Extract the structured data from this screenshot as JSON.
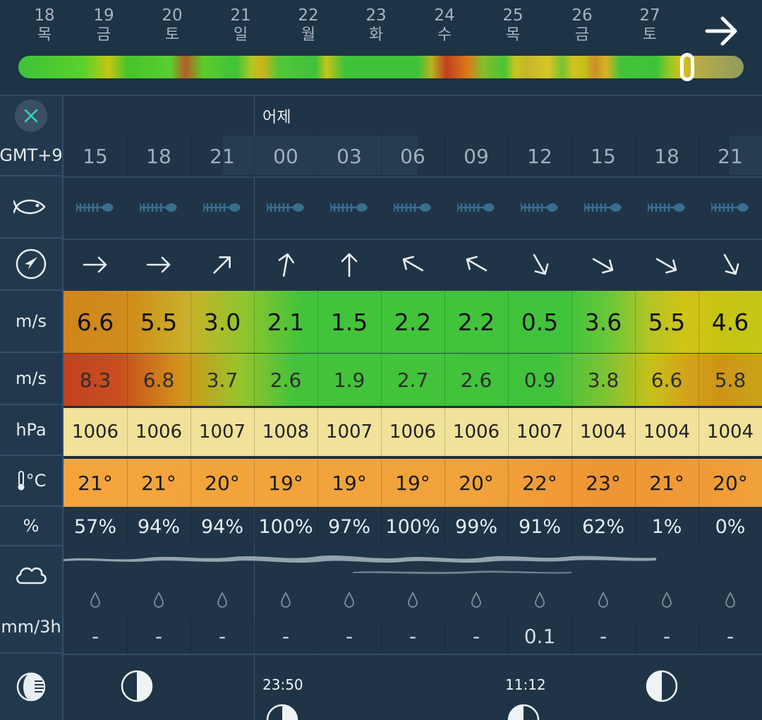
{
  "days": [
    {
      "num": "18",
      "wd": "목"
    },
    {
      "num": "19",
      "wd": "금"
    },
    {
      "num": "20",
      "wd": "토"
    },
    {
      "num": "21",
      "wd": "일"
    },
    {
      "num": "22",
      "wd": "월"
    },
    {
      "num": "23",
      "wd": "화"
    },
    {
      "num": "24",
      "wd": "수"
    },
    {
      "num": "25",
      "wd": "목"
    },
    {
      "num": "26",
      "wd": "금"
    },
    {
      "num": "27",
      "wd": "토"
    }
  ],
  "day_section_label": "어제",
  "labels": {
    "timezone": "GMT+9",
    "wind_unit": "m/s",
    "gust_unit": "m/s",
    "pressure_unit": "hPa",
    "temp_unit": "°C",
    "humidity_unit": "%",
    "precip_unit": "mm/3h"
  },
  "hours": [
    "15",
    "18",
    "21",
    "00",
    "03",
    "06",
    "09",
    "12",
    "15",
    "18",
    "21"
  ],
  "wind_dir_deg": [
    90,
    90,
    45,
    10,
    0,
    -60,
    -60,
    150,
    120,
    120,
    150
  ],
  "wind_speed": [
    "6.6",
    "5.5",
    "3.0",
    "2.1",
    "1.5",
    "2.2",
    "2.2",
    "0.5",
    "3.6",
    "5.5",
    "4.6"
  ],
  "wind_gust": [
    "8.3",
    "6.8",
    "3.7",
    "2.6",
    "1.9",
    "2.7",
    "2.6",
    "0.9",
    "3.8",
    "6.6",
    "5.8"
  ],
  "pressure": [
    "1006",
    "1006",
    "1007",
    "1008",
    "1007",
    "1006",
    "1006",
    "1007",
    "1004",
    "1004",
    "1004"
  ],
  "temperature": [
    "21°",
    "21°",
    "20°",
    "19°",
    "19°",
    "19°",
    "20°",
    "22°",
    "23°",
    "21°",
    "20°"
  ],
  "humidity": [
    "57%",
    "94%",
    "94%",
    "100%",
    "97%",
    "100%",
    "99%",
    "91%",
    "62%",
    "1%",
    "0%"
  ],
  "precip": [
    "-",
    "-",
    "-",
    "-",
    "-",
    "-",
    "-",
    "0.1",
    "-",
    "-",
    "-"
  ],
  "moon": {
    "time_a": "23:50",
    "time_b": "11:12"
  },
  "colors": {
    "bg": "#1f3447",
    "green": "#3ec23a",
    "yellow": "#c8c614",
    "orange": "#d08a16",
    "red": "#c24322",
    "pressure": "#f1e29a",
    "temperature": "#f09c3a"
  }
}
